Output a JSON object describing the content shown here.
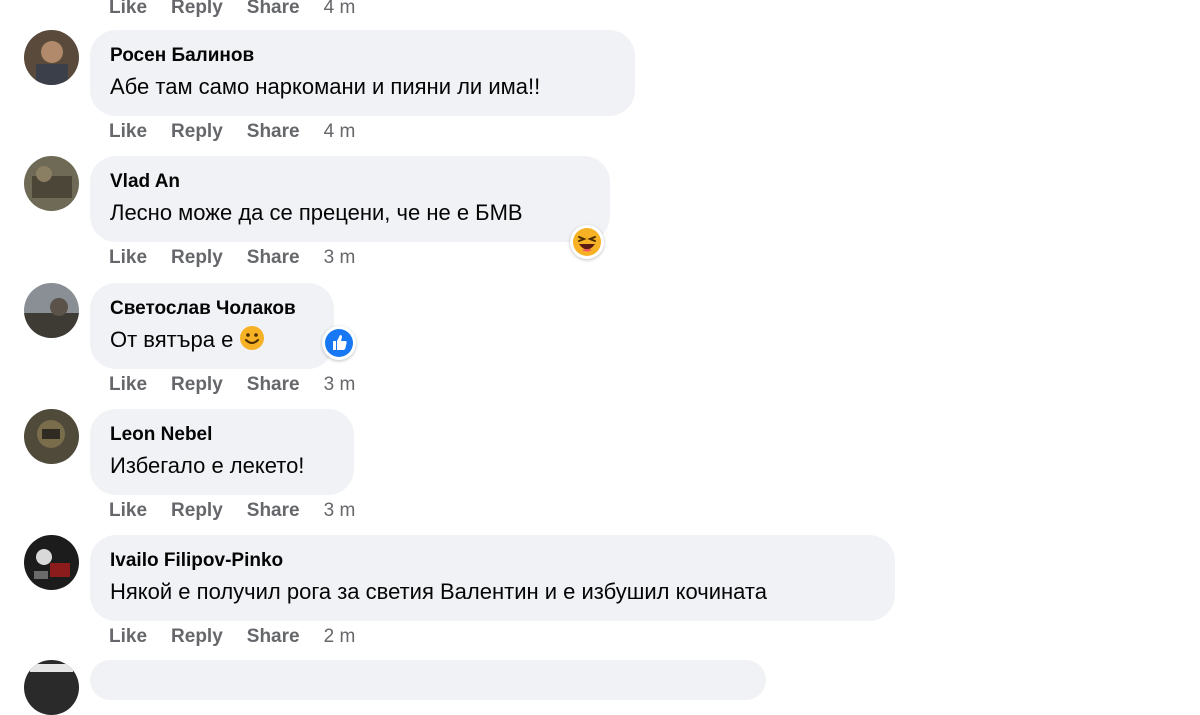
{
  "actions": {
    "like": "Like",
    "reply": "Reply",
    "share": "Share"
  },
  "top_actions": {
    "time": "4 m"
  },
  "comments": [
    {
      "author": "Росен Балинов",
      "text": "Абе там само наркомани и пияни ли има!!",
      "time": "4 m"
    },
    {
      "author": "Vlad An",
      "text": "Лесно може да се прецени, че не е БМВ",
      "time": "3 m",
      "reaction": "haha"
    },
    {
      "author": "Светослав Чолаков",
      "text": "От вятъра е",
      "time": "3 m",
      "inline_emoji": "smile",
      "reaction": "like"
    },
    {
      "author": "Leon Nebel",
      "text": "Избегало е лекето!",
      "time": "3 m"
    },
    {
      "author": "Ivailo Filipov-Pinko",
      "text": "Някой е получил рога за светия Валентин и е избушил кочината",
      "time": "2 m"
    }
  ],
  "colors": {
    "bubble": "#f0f2f5",
    "meta_text": "#65676b",
    "like_blue": "#1877f2",
    "haha_yellow": "#f7b125"
  }
}
